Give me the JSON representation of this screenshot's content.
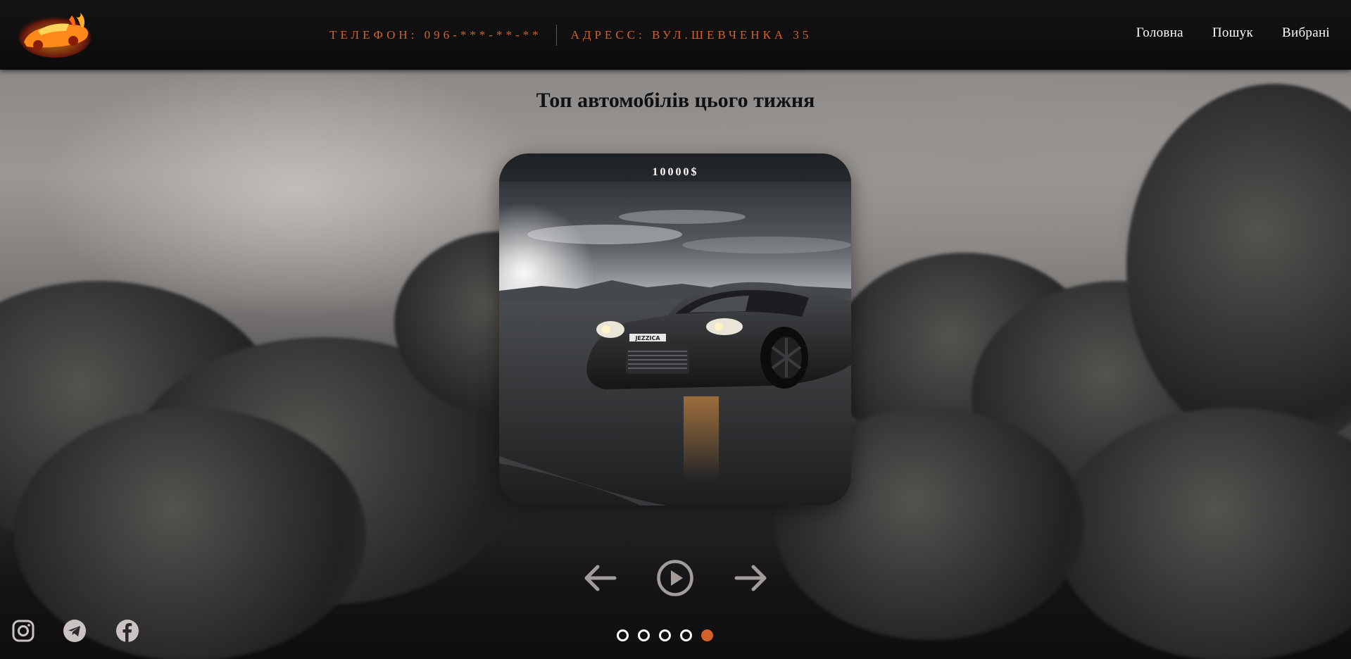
{
  "header": {
    "phone": "ТЕЛЕФОН: 096-***-**-**",
    "address": "АДРЕСС: ВУЛ.ШЕВЧЕНКА 35",
    "nav": [
      "Головна",
      "Пошук",
      "Вибрані"
    ]
  },
  "main": {
    "title": "Топ автомобілів цього тижня",
    "card": {
      "price": "10000$"
    },
    "slider": {
      "total_slides": 5,
      "active_slide": 5
    }
  },
  "colors": {
    "accent": "#d2622a",
    "header_bg": "#0b0b0b",
    "control_gray": "#a29c9b",
    "nav_text": "#ffffff"
  },
  "icons": {
    "logo": "flaming-car-logo",
    "prev": "arrow-left-icon",
    "play": "play-circle-icon",
    "next": "arrow-right-icon",
    "instagram": "instagram-icon",
    "telegram": "telegram-icon",
    "facebook": "facebook-icon"
  }
}
